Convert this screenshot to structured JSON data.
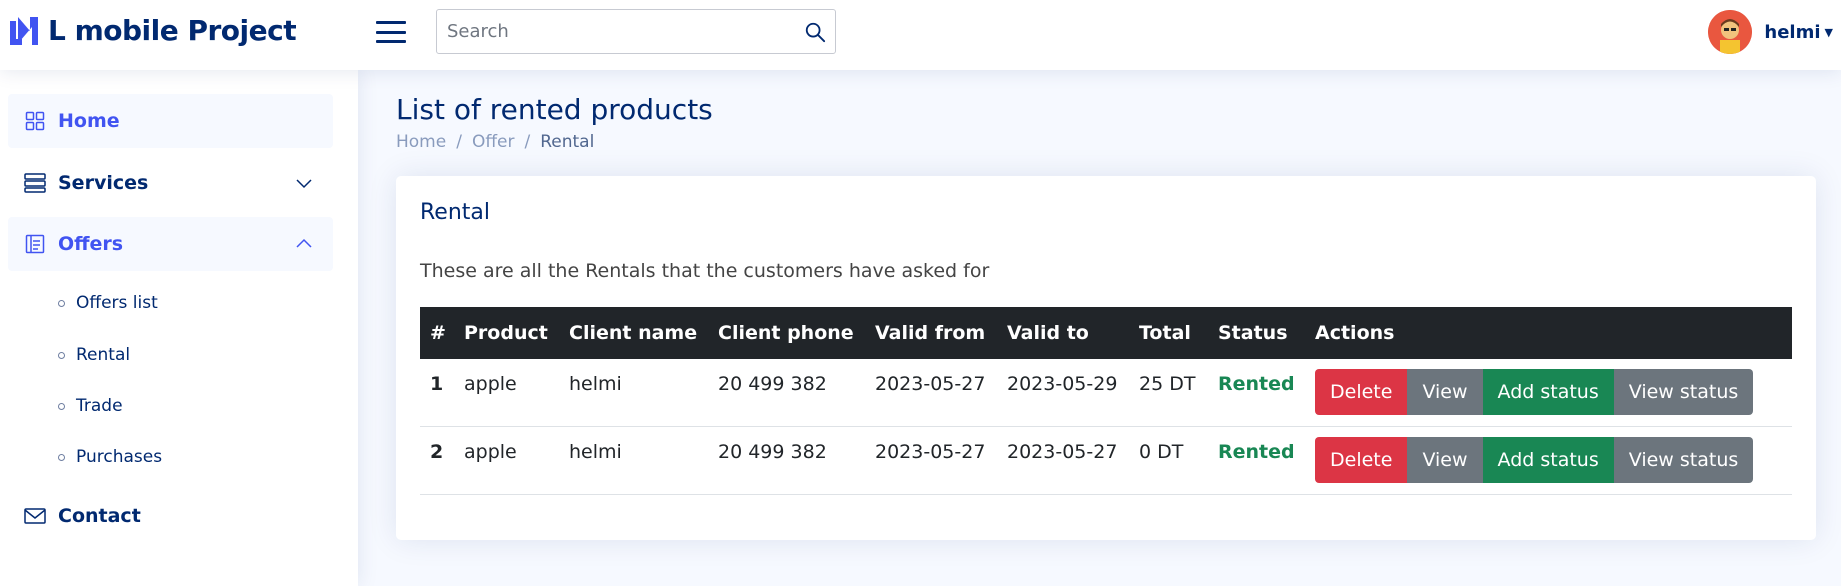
{
  "header": {
    "logo_text": "L mobile Project",
    "search_placeholder": "Search",
    "username": "helmi"
  },
  "sidebar": {
    "items": [
      {
        "label": "Home",
        "icon": "grid-icon"
      },
      {
        "label": "Services",
        "icon": "server-icon"
      },
      {
        "label": "Offers",
        "icon": "layout-text-icon"
      },
      {
        "label": "Contact",
        "icon": "envelope-icon"
      }
    ],
    "offers_sub": [
      {
        "label": "Offers list"
      },
      {
        "label": "Rental"
      },
      {
        "label": "Trade"
      },
      {
        "label": "Purchases"
      }
    ]
  },
  "page": {
    "title": "List of rented products",
    "breadcrumb": [
      "Home",
      "Offer",
      "Rental"
    ]
  },
  "card": {
    "title": "Rental",
    "description": "These are all the Rentals that the customers have asked for",
    "columns": [
      "#",
      "Product",
      "Client name",
      "Client phone",
      "Valid from",
      "Valid to",
      "Total",
      "Status",
      "Actions"
    ],
    "rows": [
      {
        "num": "1",
        "product": "apple",
        "client": "helmi",
        "phone": "20 499 382",
        "from": "2023-05-27",
        "to": "2023-05-29",
        "total": "25 DT",
        "status": "Rented"
      },
      {
        "num": "2",
        "product": "apple",
        "client": "helmi",
        "phone": "20 499 382",
        "from": "2023-05-27",
        "to": "2023-05-27",
        "total": "0 DT",
        "status": "Rented"
      }
    ],
    "actions": {
      "delete": "Delete",
      "view": "View",
      "add_status": "Add status",
      "view_status": "View status"
    }
  },
  "colors": {
    "brand": "#012970",
    "accent": "#4154f1",
    "danger": "#dc3545",
    "success": "#198754",
    "secondary": "#6c757d",
    "table_head": "#212529"
  }
}
